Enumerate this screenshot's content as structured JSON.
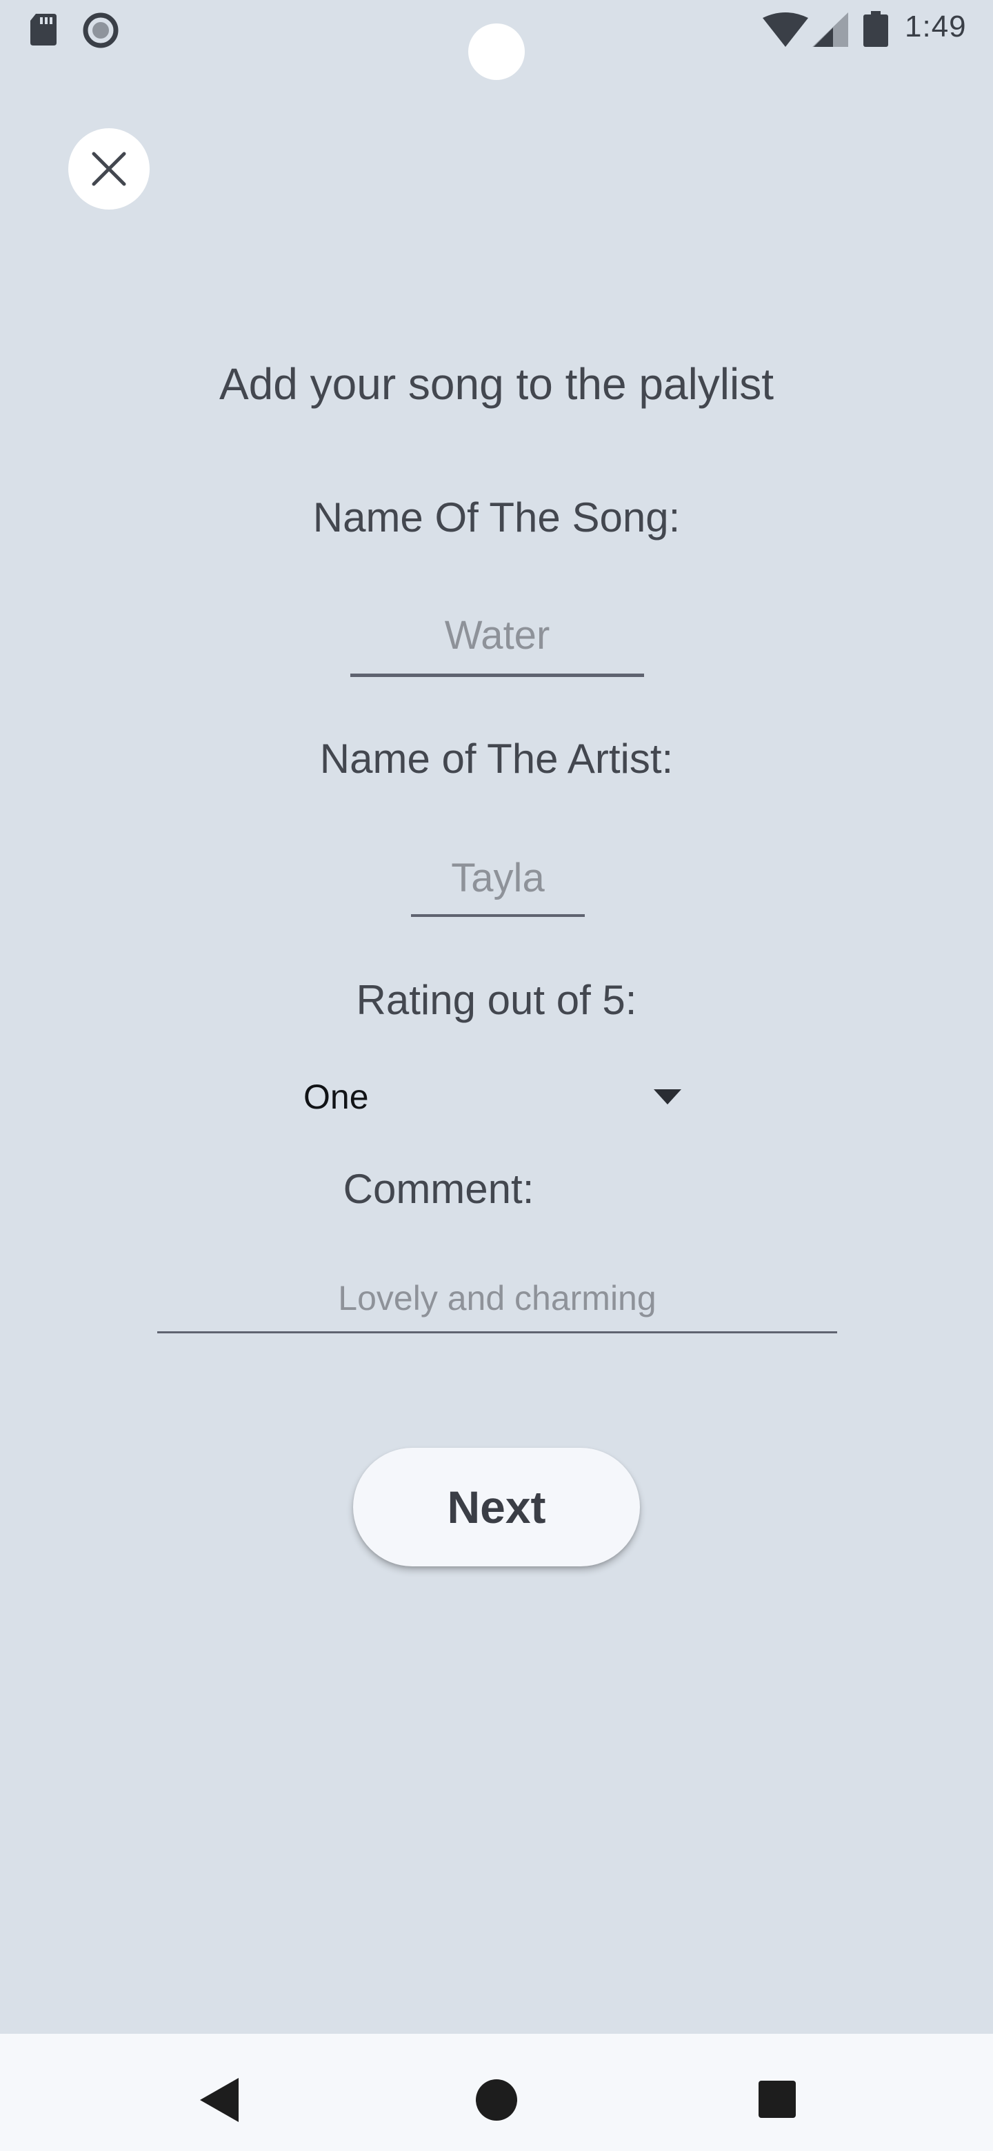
{
  "status_bar": {
    "time": "1:49",
    "icons": [
      "sd-card-icon",
      "record-icon",
      "wifi-icon",
      "signal-icon",
      "battery-icon"
    ]
  },
  "close_icon": "close-icon",
  "heading": "Add your song to the palylist",
  "form": {
    "song_label": "Name Of The Song:",
    "song_value": "Water",
    "artist_label": "Name of The Artist:",
    "artist_value": "Tayla",
    "rating_label": "Rating out of 5:",
    "rating_value": "One",
    "comment_label": "Comment:",
    "comment_value": "Lovely and charming"
  },
  "next_label": "Next",
  "nav_bar": {
    "icons": [
      "back-icon",
      "home-icon",
      "recents-icon"
    ]
  },
  "colors": {
    "background": "#d9e0e8",
    "button": "#f5f7fb",
    "text": "#43474f",
    "hint": "#8e9299"
  }
}
